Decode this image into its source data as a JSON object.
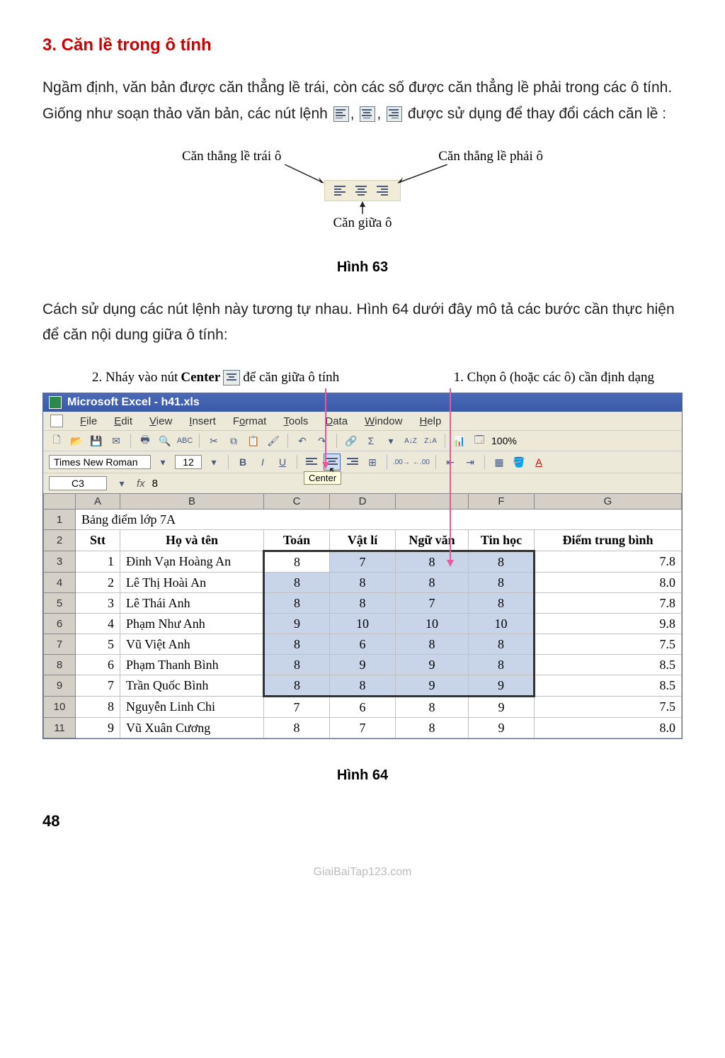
{
  "heading": "3. Căn lề trong ô tính",
  "para1_a": "Ngầm định, văn bản được căn thẳng lề trái, còn các số được căn thẳng lề phải trong các ô tính. Giống như soạn thảo văn bản, các nút lệnh ",
  "para1_b": " được sử dụng để thay đổi cách căn lề :",
  "fig63": {
    "left_label": "Căn thẳng lề trái ô",
    "right_label": "Căn thẳng lề phải ô",
    "bottom_label": "Căn giữa ô",
    "caption": "Hình 63"
  },
  "para2": "Cách sử dụng các nút lệnh này tương tự nhau. Hình 64 dưới đây mô tả các bước cần thực hiện để căn nội dung giữa ô tính:",
  "fig64": {
    "callout1_a": "2. Nháy vào nút ",
    "callout1_b": "Center",
    "callout1_c": " để căn giữa ô tính",
    "callout2": "1. Chọn ô (hoặc các ô) cần định dạng",
    "caption": "Hình 64"
  },
  "excel": {
    "title": "Microsoft Excel - h41.xls",
    "menu": [
      "File",
      "Edit",
      "View",
      "Insert",
      "Format",
      "Tools",
      "Data",
      "Window",
      "Help"
    ],
    "font": "Times New Roman",
    "fontsize": "12",
    "zoom": "100%",
    "namebox": "C3",
    "fx": "8",
    "tooltip": "Center",
    "cols": [
      "A",
      "B",
      "C",
      "D",
      "",
      "F",
      "G"
    ],
    "row1_title": "Bảng điểm lớp 7A",
    "headers": [
      "Stt",
      "Họ và tên",
      "Toán",
      "Vật lí",
      "Ngữ văn",
      "Tin học",
      "Điểm trung bình"
    ],
    "rows": [
      {
        "r": "3",
        "stt": "1",
        "name": "Đinh Vạn Hoàng An",
        "toan": "8",
        "vl": "7",
        "nv": "8",
        "th": "8",
        "dtb": "7.8"
      },
      {
        "r": "4",
        "stt": "2",
        "name": "Lê Thị Hoài An",
        "toan": "8",
        "vl": "8",
        "nv": "8",
        "th": "8",
        "dtb": "8.0"
      },
      {
        "r": "5",
        "stt": "3",
        "name": "Lê Thái Anh",
        "toan": "8",
        "vl": "8",
        "nv": "7",
        "th": "8",
        "dtb": "7.8"
      },
      {
        "r": "6",
        "stt": "4",
        "name": "Phạm Như Anh",
        "toan": "9",
        "vl": "10",
        "nv": "10",
        "th": "10",
        "dtb": "9.8"
      },
      {
        "r": "7",
        "stt": "5",
        "name": "Vũ Việt Anh",
        "toan": "8",
        "vl": "6",
        "nv": "8",
        "th": "8",
        "dtb": "7.5"
      },
      {
        "r": "8",
        "stt": "6",
        "name": "Phạm Thanh Bình",
        "toan": "8",
        "vl": "9",
        "nv": "9",
        "th": "8",
        "dtb": "8.5"
      },
      {
        "r": "9",
        "stt": "7",
        "name": "Trần Quốc Bình",
        "toan": "8",
        "vl": "8",
        "nv": "9",
        "th": "9",
        "dtb": "8.5"
      },
      {
        "r": "10",
        "stt": "8",
        "name": "Nguyễn Linh Chi",
        "toan": "7",
        "vl": "6",
        "nv": "8",
        "th": "9",
        "dtb": "7.5"
      },
      {
        "r": "11",
        "stt": "9",
        "name": "Vũ Xuân Cương",
        "toan": "8",
        "vl": "7",
        "nv": "8",
        "th": "9",
        "dtb": "8.0"
      }
    ]
  },
  "page_num": "48",
  "watermark": "GiaiBaiTap123.com"
}
